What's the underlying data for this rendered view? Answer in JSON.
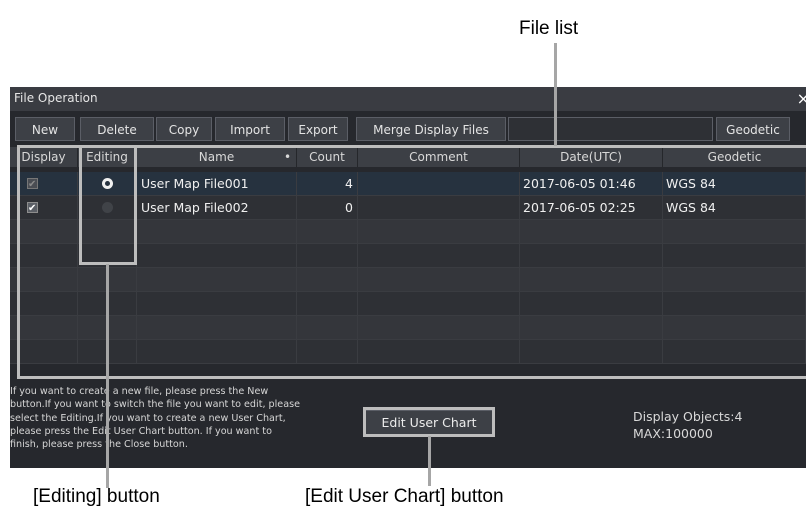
{
  "callouts": {
    "file_list": "File list",
    "editing_button": "[Editing] button",
    "edit_user_chart_button": "[Edit User Chart] button"
  },
  "window": {
    "title": "File Operation",
    "close_glyph": "×"
  },
  "toolbar": {
    "new": "New",
    "delete": "Delete",
    "copy": "Copy",
    "import": "Import",
    "export": "Export",
    "merge": "Merge Display Files",
    "geodetic": "Geodetic"
  },
  "table": {
    "columns": {
      "display": "Display",
      "editing": "Editing",
      "name": "Name",
      "sort_indicator": "•",
      "count": "Count",
      "comment": "Comment",
      "date": "Date(UTC)",
      "geodetic": "Geodetic"
    },
    "rows": [
      {
        "display": "checked-dim",
        "editing": "selected",
        "name": "User Map File001",
        "count": "4",
        "comment": "",
        "date": "2017-06-05 01:46",
        "geodetic": "WGS 84"
      },
      {
        "display": "checked",
        "editing": "unselected",
        "name": "User Map File002",
        "count": "0",
        "comment": "",
        "date": "2017-06-05 02:25",
        "geodetic": "WGS 84"
      }
    ]
  },
  "help_lines": [
    "If you want to create a new file, please press the New",
    "button.If you want to switch the file you want to edit, please",
    "select the Editing.If you want to create a new User Chart,",
    "please press the Edit User Chart button. If you want to",
    "finish, please press the Close button."
  ],
  "edit_user_chart_label": "Edit User Chart",
  "status": {
    "display_objects": "Display Objects:4",
    "max": "MAX:100000"
  },
  "colors": {
    "window_bg": "#26282d",
    "selected_row": "#26323f",
    "highlight_frame": "#bdbdbd"
  }
}
